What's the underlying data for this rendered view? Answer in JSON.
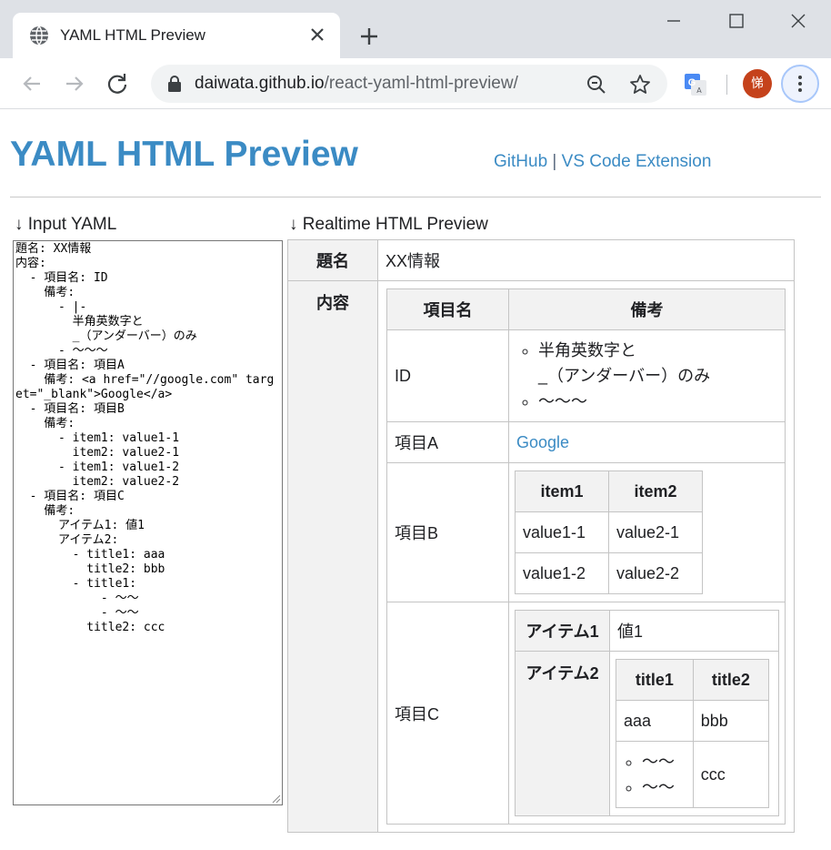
{
  "browser": {
    "tab_title": "YAML HTML Preview",
    "url_host": "daiwata.github.io",
    "url_path": "/react-yaml-html-preview/",
    "avatar_text": "悌"
  },
  "page": {
    "title": "YAML HTML Preview",
    "link_github": "GitHub",
    "link_separator": "|",
    "link_vscode": "VS Code Extension",
    "input_label": "↓ Input YAML",
    "preview_label": "↓ Realtime HTML Preview",
    "yaml_text": "題名: XX情報\n内容:\n  - 項目名: ID\n    備考:\n      - |-\n        半角英数字と\n        _（アンダーバー）のみ\n      - 〜〜〜\n  - 項目名: 項目A\n    備考: <a href=\"//google.com\" target=\"_blank\">Google</a>\n  - 項目名: 項目B\n    備考:\n      - item1: value1-1\n        item2: value2-1\n      - item1: value1-2\n        item2: value2-2\n  - 項目名: 項目C\n    備考:\n      アイテム1: 値1\n      アイテム2:\n        - title1: aaa\n          title2: bbb\n        - title1:\n            - 〜〜\n            - 〜〜\n          title2: ccc"
  },
  "preview": {
    "k_title": "題名",
    "v_title": "XX情報",
    "k_content": "内容",
    "col_name": "項目名",
    "col_note": "備考",
    "rows": [
      {
        "name": "ID",
        "note_items": [
          "半角英数字と",
          "_（アンダーバー）のみ",
          "〜〜〜"
        ]
      },
      {
        "name": "項目A",
        "note_link": "Google"
      },
      {
        "name": "項目B",
        "headers": [
          "item1",
          "item2"
        ],
        "cells": [
          [
            "value1-1",
            "value2-1"
          ],
          [
            "value1-2",
            "value2-2"
          ]
        ]
      },
      {
        "name": "項目C",
        "item1_key": "アイテム1",
        "item1_val": "値1",
        "item2_key": "アイテム2",
        "sub_headers": [
          "title1",
          "title2"
        ],
        "sub_row1": [
          "aaa",
          "bbb"
        ],
        "sub_row2_list": [
          "〜〜",
          "〜〜"
        ],
        "sub_row2_title2": "ccc"
      }
    ]
  },
  "colors": {
    "brand": "#3b8bc4",
    "header_bg": "#f2f2f2",
    "avatar": "#c5421b"
  }
}
